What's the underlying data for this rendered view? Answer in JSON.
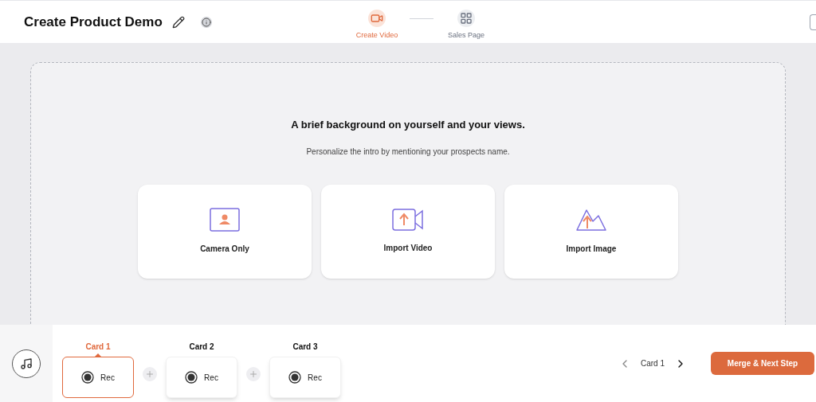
{
  "header": {
    "title": "Create Product Demo"
  },
  "steps": [
    {
      "label": "Create Video",
      "kind": "video",
      "selected": true
    },
    {
      "label": "Sales Page",
      "kind": "layout",
      "selected": false
    }
  ],
  "prompt": {
    "heading": "A brief background on yourself and your views.",
    "subtext": "Personalize the intro by mentioning your prospects name."
  },
  "options": [
    {
      "label": "Camera Only",
      "kind": "camera"
    },
    {
      "label": "Import Video",
      "kind": "video"
    },
    {
      "label": "Import Image",
      "kind": "image"
    }
  ],
  "cards": [
    {
      "title": "Card 1",
      "action": "Rec",
      "selected": true
    },
    {
      "title": "Card 2",
      "action": "Rec",
      "selected": false
    },
    {
      "title": "Card 3",
      "action": "Rec",
      "selected": false
    }
  ],
  "pager": {
    "label": "Card 1"
  },
  "next_button": "Merge & Next Step"
}
